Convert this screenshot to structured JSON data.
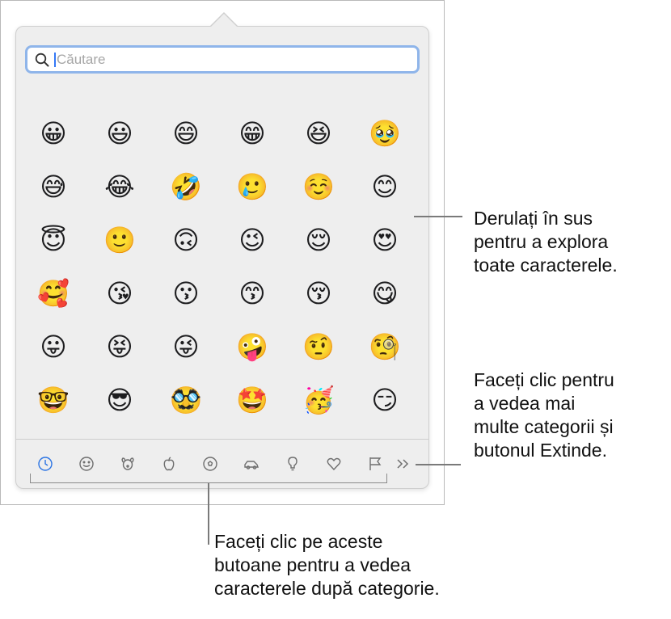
{
  "search": {
    "placeholder": "Căutare"
  },
  "emoji_rows": [
    [
      "😀",
      "😃",
      "😄",
      "😁",
      "😆",
      "🥹"
    ],
    [
      "😅",
      "😂",
      "🤣",
      "🥲",
      "☺️",
      "😊"
    ],
    [
      "😇",
      "🙂",
      "🙃",
      "😉",
      "😌",
      "😍"
    ],
    [
      "🥰",
      "😘",
      "😗",
      "😙",
      "😚",
      "😋"
    ],
    [
      "😛",
      "😝",
      "😜",
      "🤪",
      "🤨",
      "🧐"
    ],
    [
      "🤓",
      "😎",
      "🥸",
      "🤩",
      "🥳",
      "😏"
    ]
  ],
  "categories": [
    {
      "name": "recent",
      "icon": "clock-icon",
      "active": true
    },
    {
      "name": "smileys",
      "icon": "smiley-icon"
    },
    {
      "name": "animals",
      "icon": "dog-icon"
    },
    {
      "name": "food",
      "icon": "apple-icon"
    },
    {
      "name": "activity",
      "icon": "ball-icon"
    },
    {
      "name": "travel",
      "icon": "car-icon"
    },
    {
      "name": "objects",
      "icon": "lightbulb-icon"
    },
    {
      "name": "symbols",
      "icon": "heart-icon"
    },
    {
      "name": "flags",
      "icon": "flag-icon"
    }
  ],
  "expand": {
    "icon": "double-chevron-right-icon"
  },
  "callouts": {
    "scroll": [
      "Derulați în sus",
      "pentru a explora",
      "toate caracterele."
    ],
    "more": [
      "Faceți clic pentru",
      "a vedea mai",
      "multe categorii și",
      "butonul Extinde."
    ],
    "categories": [
      "Faceți clic pe aceste",
      "butoane pentru a vedea",
      "caracterele după categorie."
    ]
  },
  "colors": {
    "accent": "#2b74e4",
    "focus_ring": "#8fb5ea"
  }
}
